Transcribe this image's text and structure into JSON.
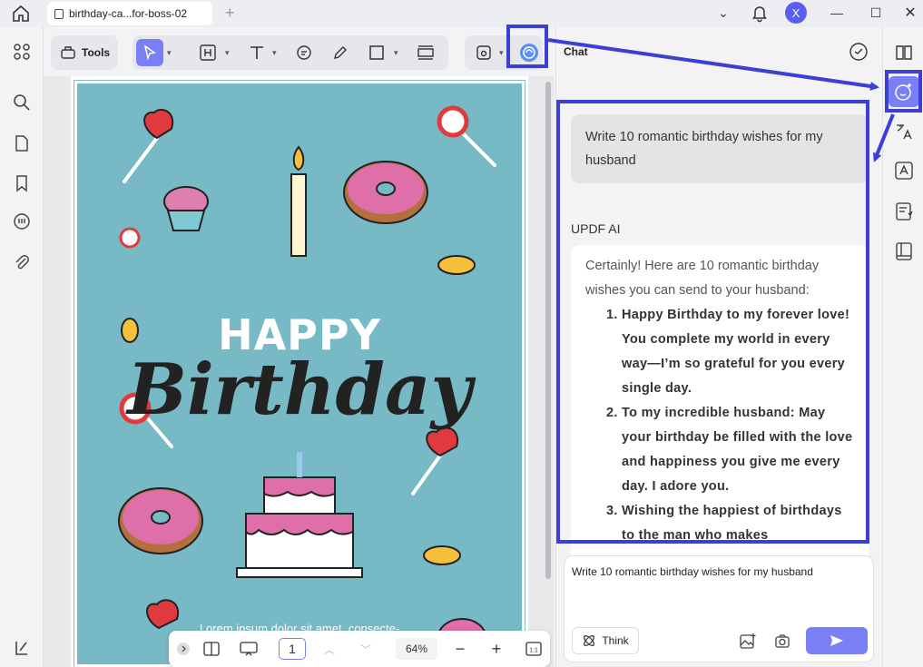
{
  "window": {
    "tab_title": "birthday-ca...for-boss-02",
    "user_initial": "X"
  },
  "toolbar": {
    "tools_label": "Tools"
  },
  "document": {
    "happy_text": "HAPPY",
    "birthday_text": "Birthday",
    "lorem_text": "Lorem ipsum dolor sit amet, consecte-"
  },
  "pagebar": {
    "page_number": "1",
    "zoom_level": "64%"
  },
  "chat": {
    "title": "Chat",
    "user_message": "Write 10 romantic birthday wishes for my husband",
    "ai_label": "UPDF AI",
    "ai_intro": "Certainly! Here are 10 romantic birthday wishes you can send to your husband:",
    "ai_items": [
      "Happy Birthday to my forever love! You complete my world in every way—I’m so grateful for you every single day.",
      "To my incredible husband: May your birthday be filled with the love and happiness you give me every day. I adore you.",
      "Wishing the happiest of birthdays to the man who makes"
    ],
    "input_value": "Write 10 romantic birthday wishes for my husband",
    "think_label": "Think"
  },
  "colors": {
    "accent": "#7b7ff5",
    "annotation": "#3b3fd6",
    "card_bg": "#77b9c5"
  }
}
